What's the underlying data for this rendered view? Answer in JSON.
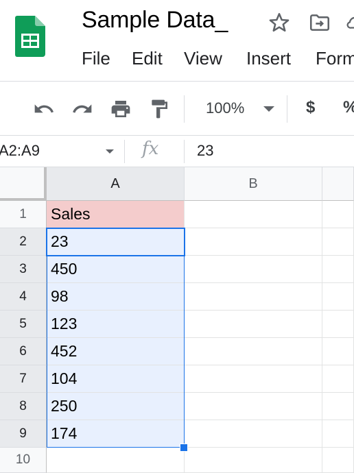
{
  "document": {
    "title": "Sample Data_"
  },
  "menu": {
    "items": [
      "File",
      "Edit",
      "View",
      "Insert",
      "Form"
    ]
  },
  "toolbar": {
    "zoom": "100%",
    "currency_label": "$",
    "percent_label": "%"
  },
  "formula_bar": {
    "name_box": "A2:A9",
    "fx_label": "fx",
    "value": "23"
  },
  "grid": {
    "columns": [
      "A",
      "B"
    ],
    "rows": [
      "1",
      "2",
      "3",
      "4",
      "5",
      "6",
      "7",
      "8",
      "9",
      "10"
    ],
    "cells_a": [
      "Sales",
      "23",
      "450",
      "98",
      "123",
      "452",
      "104",
      "250",
      "174",
      ""
    ],
    "selection": "A2:A9",
    "active_cell": "A2"
  },
  "colors": {
    "selection_border": "#1a73e8",
    "selection_fill": "#e8f0fe",
    "header_cell_fill": "#f4cccc",
    "sheets_logo_green": "#0f9d58"
  },
  "icons": {
    "logo": "google-sheets-logo",
    "star": "star-icon",
    "move": "move-to-folder-icon",
    "undo": "undo-icon",
    "redo": "redo-icon",
    "print": "print-icon",
    "paint_format": "paint-format-icon"
  }
}
